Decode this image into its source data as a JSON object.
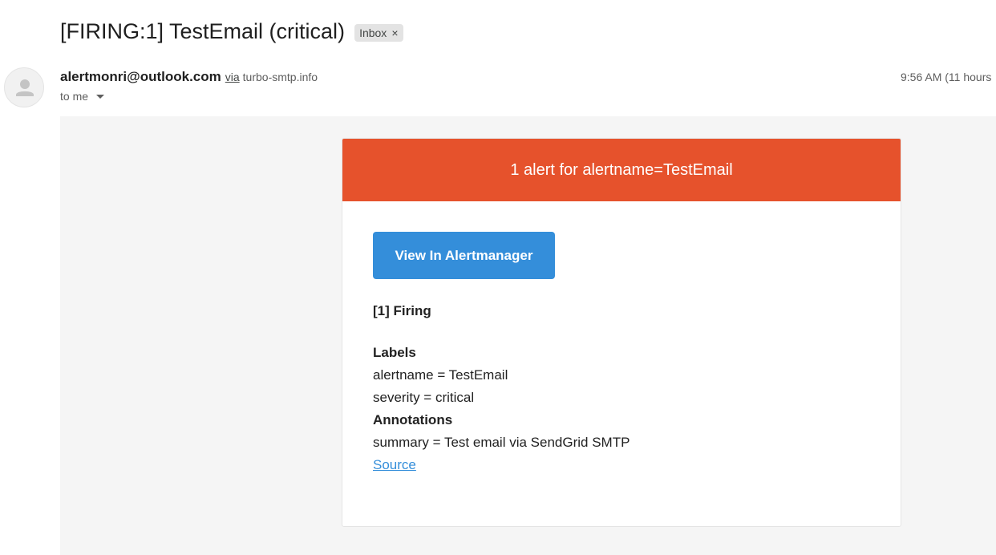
{
  "email": {
    "subject": "[FIRING:1] TestEmail (critical)",
    "label": "Inbox",
    "label_close": "×"
  },
  "sender": {
    "name": "alertmonri@outlook.com",
    "via_label": "via",
    "via_domain": "turbo-smtp.info",
    "recipient": "to me",
    "timestamp": "9:56 AM (11 hours"
  },
  "icons": {
    "avatar": "person-avatar-icon",
    "recipient_dropdown": "dropdown-arrow-icon",
    "label_close": "close-icon"
  },
  "card": {
    "header": "1 alert for alertname=TestEmail",
    "button_label": "View In Alertmanager",
    "firing_title": "[1] Firing",
    "labels_title": "Labels",
    "labels": [
      "alertname = TestEmail",
      "severity = critical"
    ],
    "annotations_title": "Annotations",
    "annotations": [
      "summary = Test email via SendGrid SMTP"
    ],
    "source_link": "Source"
  },
  "colors": {
    "header_bg": "#e6522c",
    "button_bg": "#348eda",
    "link": "#348eda",
    "body_bg": "#f5f5f5",
    "chip_bg": "#e3e3e3"
  }
}
